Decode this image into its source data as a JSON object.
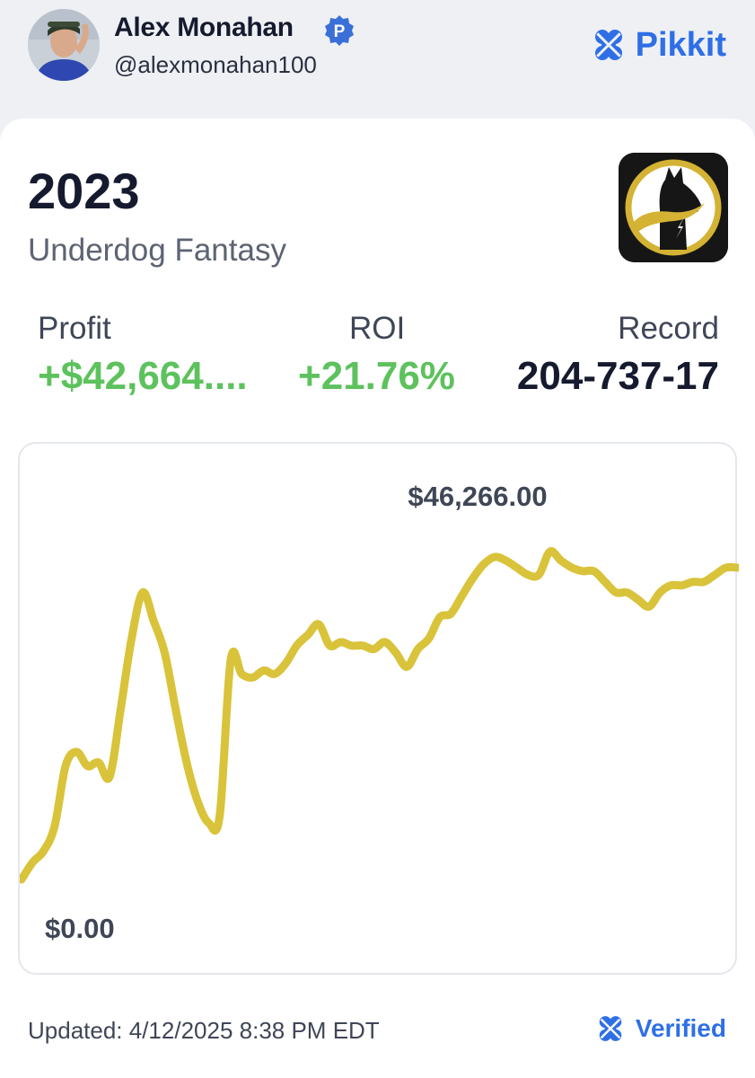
{
  "header": {
    "user_name": "Alex Monahan",
    "user_handle": "@alexmonahan100",
    "brand": "Pikkit",
    "icons": {
      "badge": "verified-p-badge-icon",
      "brand": "clover-icon"
    }
  },
  "card": {
    "year": "2023",
    "sportsbook": "Underdog Fantasy",
    "stats": {
      "profit_label": "Profit",
      "profit_value": "+$42,664....",
      "roi_label": "ROI",
      "roi_value": "+21.76%",
      "record_label": "Record",
      "record_value": "204-737-17"
    },
    "colors": {
      "positive": "#5dc25d",
      "accent": "#2f6fe6",
      "line": "#d9c33a"
    }
  },
  "chart_data": {
    "type": "line",
    "min_label": "$0.00",
    "max_label": "$46,266.00",
    "ylim": [
      0,
      46266
    ],
    "grid": false,
    "series": [
      {
        "values": [
          0,
          2400,
          4000,
          7500,
          16000,
          18000,
          16000,
          16500,
          14500,
          24000,
          34000,
          40500,
          36500,
          32000,
          24000,
          16500,
          11000,
          8000,
          9000,
          31000,
          29000,
          28500,
          29500,
          29000,
          30500,
          33000,
          34500,
          36000,
          33000,
          33500,
          33000,
          33000,
          32500,
          33500,
          32000,
          30000,
          32500,
          34000,
          37000,
          37500,
          40000,
          42500,
          44500,
          45500,
          45000,
          44000,
          43000,
          43000,
          46266,
          45000,
          44000,
          43500,
          43500,
          42000,
          40500,
          40500,
          39500,
          38500,
          40500,
          41500,
          41500,
          42000,
          42000,
          43000,
          44000,
          44000
        ]
      }
    ]
  },
  "footer": {
    "updated": "Updated: 4/12/2025 8:38 PM EDT",
    "verified": "Verified",
    "icons": {
      "verified": "clover-icon"
    }
  }
}
